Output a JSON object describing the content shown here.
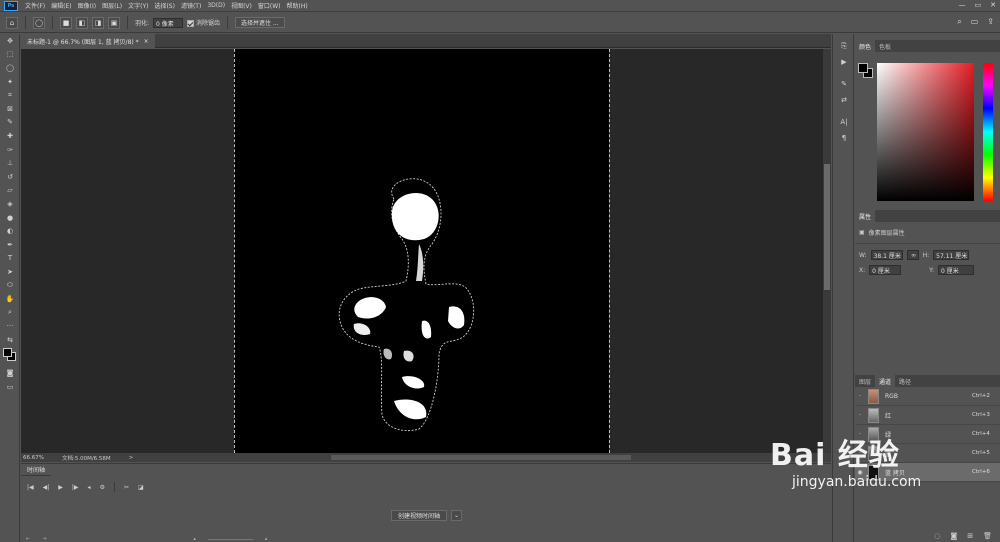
{
  "app": {
    "logo": "Ps"
  },
  "menu": [
    "文件(F)",
    "编辑(E)",
    "图像(I)",
    "图层(L)",
    "文字(Y)",
    "选择(S)",
    "滤镜(T)",
    "3D(D)",
    "视图(V)",
    "窗口(W)",
    "帮助(H)"
  ],
  "window_controls": [
    "—",
    "▭",
    "✕"
  ],
  "options": {
    "feather_label": "羽化:",
    "feather_value": "0 像素",
    "antialias_label": "消除锯齿",
    "select_mask_button": "选择并遮住 ..."
  },
  "document_tab": {
    "title": "未标题-1 @ 66.7% (图层 1, 蓝 拷贝/8) *",
    "close": "×"
  },
  "status": {
    "zoom": "66.67%",
    "doc": "文档:5.00M/6.58M",
    "arrow": ">"
  },
  "timeline": {
    "tab": "时间轴",
    "create_button": "创建视频时间轴",
    "dropdown": "⌄"
  },
  "color_panel": {
    "tabs": [
      "颜色",
      "色板"
    ]
  },
  "properties_panel": {
    "tabs": [
      "属性"
    ],
    "section": "像素图层属性",
    "w_label": "W:",
    "w_value": "38.1 厘米",
    "h_label": "H:",
    "h_value": "57.11 厘米",
    "x_label": "X:",
    "x_value": "0 厘米",
    "y_label": "Y:",
    "y_value": "0 厘米"
  },
  "channels_panel": {
    "tabs": [
      "图层",
      "通道",
      "路径"
    ],
    "rows": [
      {
        "name": "RGB",
        "shortcut": "Ctrl+2"
      },
      {
        "name": "红",
        "shortcut": "Ctrl+3"
      },
      {
        "name": "绿",
        "shortcut": "Ctrl+4"
      },
      {
        "name": "蓝",
        "shortcut": "Ctrl+5"
      },
      {
        "name": "蓝 拷贝",
        "shortcut": "Ctrl+6"
      }
    ]
  },
  "watermark": {
    "brand": "Bai  经验",
    "url": "jingyan.baidu.com"
  }
}
